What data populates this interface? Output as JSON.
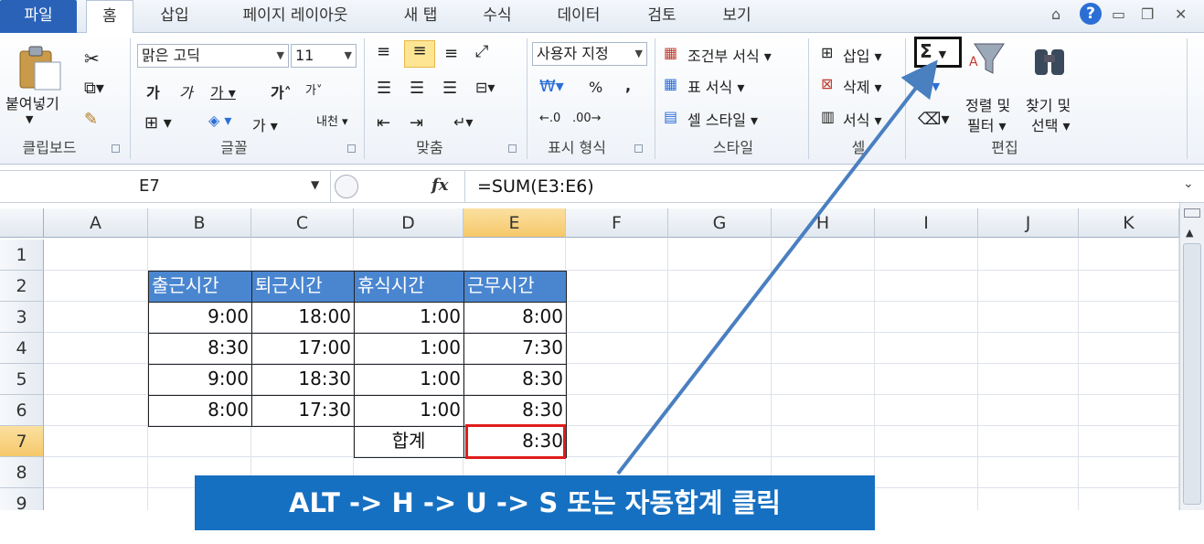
{
  "tabs": [
    {
      "label": "파일",
      "type": "file"
    },
    {
      "label": "홈",
      "type": "active"
    },
    {
      "label": "삽입",
      "type": ""
    },
    {
      "label": "페이지 레이아웃",
      "type": ""
    },
    {
      "label": "새 탭",
      "type": ""
    },
    {
      "label": "수식",
      "type": ""
    },
    {
      "label": "데이터",
      "type": ""
    },
    {
      "label": "검토",
      "type": ""
    },
    {
      "label": "보기",
      "type": ""
    }
  ],
  "ribbon": {
    "clipboard": {
      "paste": "붙여넣기",
      "group": "클립보드"
    },
    "font": {
      "name": "맑은 고딕",
      "size": "11",
      "group": "글꼴"
    },
    "alignment": {
      "group": "맞춤"
    },
    "number": {
      "format": "사용자 지정",
      "percent": "%",
      "comma": ",",
      "group": "표시 형식"
    },
    "styles": {
      "conditional": "조건부 서식",
      "table": "표 서식",
      "cell": "셀 스타일",
      "group": "스타일"
    },
    "cells": {
      "insert": "삽입",
      "delete": "삭제",
      "format": "서식",
      "group": "셀"
    },
    "editing": {
      "autosum": "Σ",
      "sort1": "정렬 및",
      "sort2": "필터",
      "find1": "찾기 및",
      "find2": "선택",
      "group": "편집"
    }
  },
  "formula_bar": {
    "name_box": "E7",
    "fx": "fx",
    "formula": "=SUM(E3:E6)"
  },
  "columns": [
    "A",
    "B",
    "C",
    "D",
    "E",
    "F",
    "G",
    "H",
    "I",
    "J",
    "K"
  ],
  "rows": [
    "1",
    "2",
    "3",
    "4",
    "5",
    "6",
    "7",
    "8",
    "9"
  ],
  "table": {
    "headers": [
      "출근시간",
      "퇴근시간",
      "휴식시간",
      "근무시간"
    ],
    "rows": [
      [
        "9:00",
        "18:00",
        "1:00",
        "8:00"
      ],
      [
        "8:30",
        "17:00",
        "1:00",
        "7:30"
      ],
      [
        "9:00",
        "18:30",
        "1:00",
        "8:30"
      ],
      [
        "8:00",
        "17:30",
        "1:00",
        "8:30"
      ]
    ],
    "total_label": "합계",
    "total_value": "8:30"
  },
  "callout": "ALT -> H -> U -> S 또는 자동합계 클릭",
  "colors": {
    "header_fill": "#4a86d0",
    "callout": "#1670c1",
    "highlight_box": "#e01c1c",
    "arrow": "#4a7fc0"
  }
}
